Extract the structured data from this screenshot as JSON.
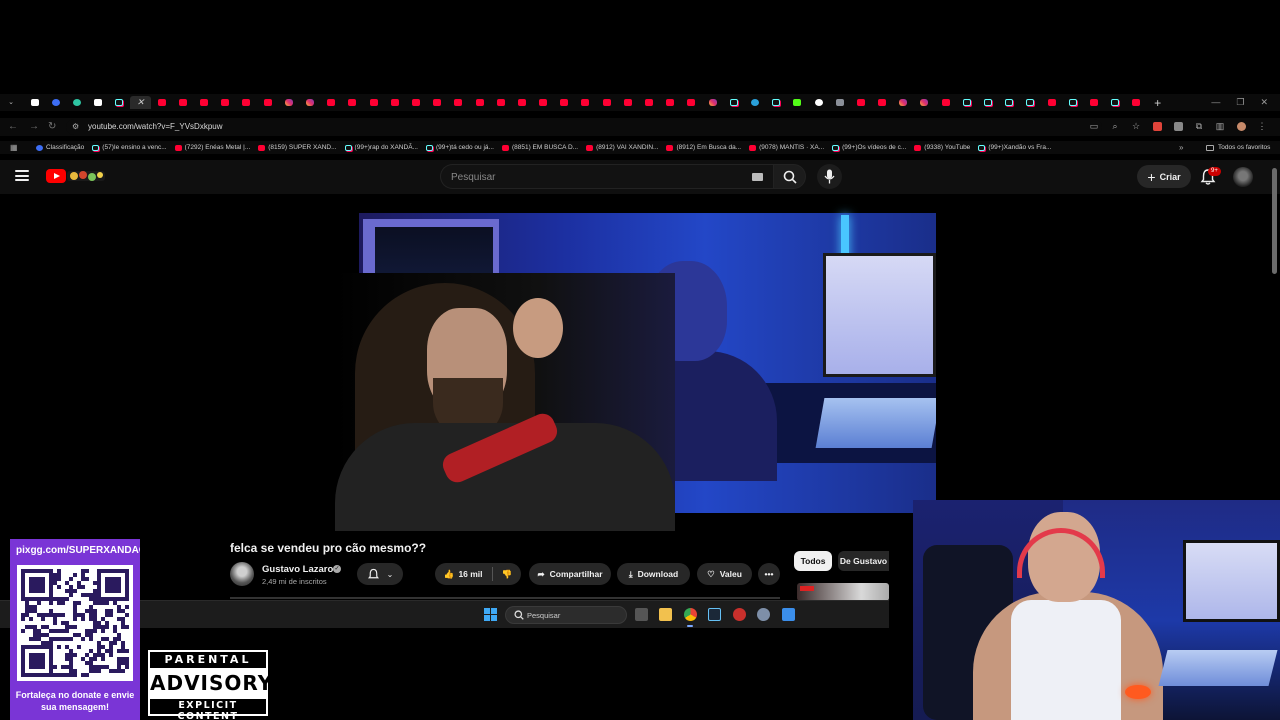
{
  "browser": {
    "tabs": [
      "doc",
      "blue",
      "green",
      "doc",
      "tt",
      "close",
      "yt",
      "yt",
      "yt",
      "yt",
      "yt",
      "yt",
      "ig",
      "ig",
      "yt",
      "yt",
      "yt",
      "yt",
      "yt",
      "yt",
      "yt",
      "yt",
      "yt",
      "yt",
      "yt",
      "yt",
      "yt",
      "yt",
      "yt",
      "yt",
      "yt",
      "yt",
      "ig",
      "tt",
      "tg",
      "tt",
      "kick",
      "g",
      "mon",
      "yt",
      "yt",
      "ig",
      "ig",
      "yt",
      "tt",
      "tt",
      "tt",
      "tt",
      "yt",
      "tt",
      "yt",
      "tt",
      "yt",
      "plus"
    ],
    "url": "youtube.com/watch?v=F_YVsDxkpuw",
    "bookmarks": [
      {
        "icon": "blue",
        "label": "Classificação"
      },
      {
        "icon": "tt",
        "label": "(57)Ie ensino a venc..."
      },
      {
        "icon": "yt",
        "label": "(7292) Enéas Metal |..."
      },
      {
        "icon": "yt",
        "label": "(8159) SUPER XAND..."
      },
      {
        "icon": "tt",
        "label": "(99+)rap do XANDÃ..."
      },
      {
        "icon": "tt",
        "label": "(99+)tá cedo ou já..."
      },
      {
        "icon": "yt",
        "label": "(8851) EM BUSCA D..."
      },
      {
        "icon": "yt",
        "label": "(8912) VAI XANDIN..."
      },
      {
        "icon": "yt",
        "label": "(8912) Em Busca da..."
      },
      {
        "icon": "yt",
        "label": "(9078) MANTIS · XA..."
      },
      {
        "icon": "tt",
        "label": "(99+)Os vídeos de c..."
      },
      {
        "icon": "yt",
        "label": "(9338) YouTube"
      },
      {
        "icon": "tt",
        "label": "(99+)Xandão vs Fra..."
      }
    ],
    "bookmarks_more": "»",
    "all_bookmarks": "Todos os favoritos"
  },
  "youtube": {
    "search_placeholder": "Pesquisar",
    "create_label": "Criar",
    "notif_badge": "9+",
    "video": {
      "title": "felca se vendeu pro cão mesmo??",
      "channel": "Gustavo Lazaro",
      "subscribers": "2,49 mi de inscritos",
      "likes": "16 mil",
      "share": "Compartilhar",
      "download": "Download",
      "thanks": "Valeu",
      "more": "•••"
    },
    "chips": {
      "all": "Todos",
      "channel": "De Gustavo"
    }
  },
  "taskbar": {
    "search_label": "Pesquisar"
  },
  "overlay": {
    "donate_url": "pixgg.com/SUPERXANDAO",
    "donate_message": "Fortaleça no donate e envie sua mensagem!",
    "parental_top": "PARENTAL",
    "parental_mid": "ADVISORY",
    "parental_bot": "EXPLICIT CONTENT"
  },
  "colors": {
    "youtube_red": "#ff0000",
    "donate_purple": "#7a35d6",
    "accent_blue": "#3ea6ff"
  }
}
